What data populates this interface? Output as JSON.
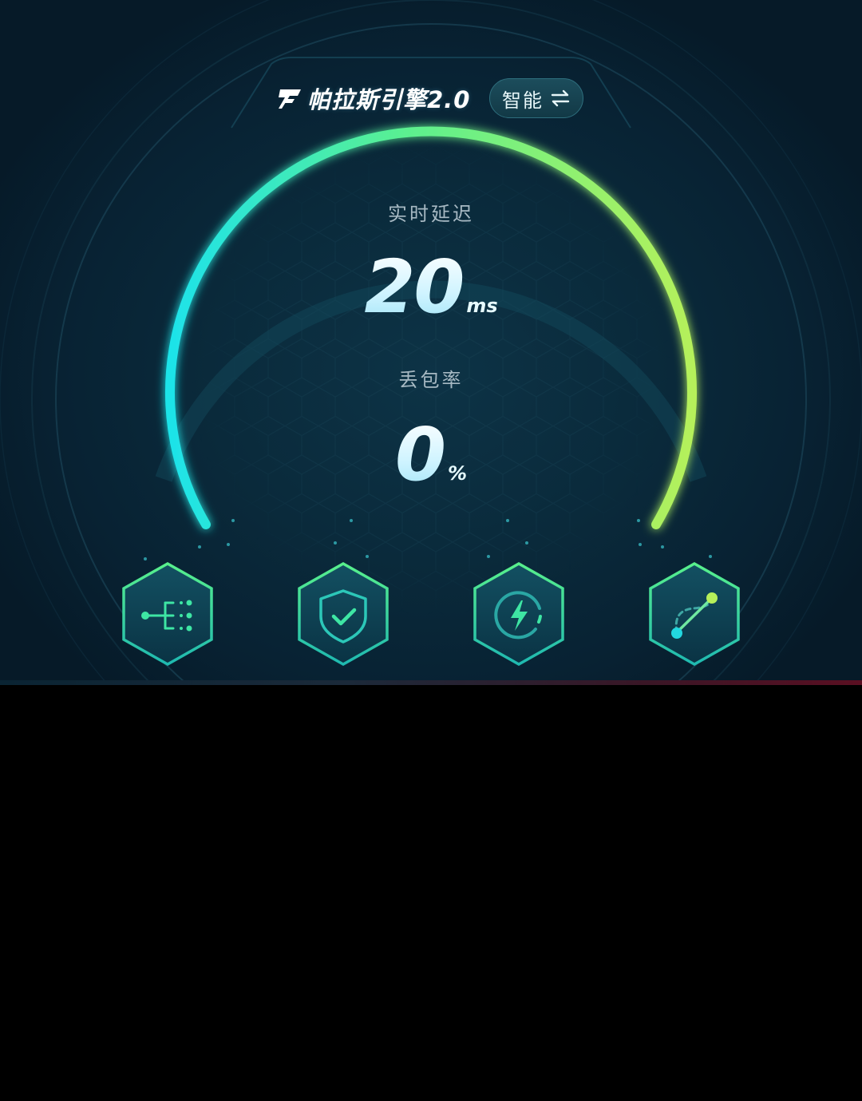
{
  "header": {
    "title": "帕拉斯引擎2.0",
    "mode_button_label": "智能"
  },
  "gauge": {
    "latency_label": "实时延迟",
    "latency_value": "20",
    "latency_unit": "ms",
    "packet_loss_label": "丢包率",
    "packet_loss_value": "0",
    "packet_loss_unit": "%"
  },
  "feature_buttons": [
    {
      "icon": "network-split-icon"
    },
    {
      "icon": "shield-check-icon"
    },
    {
      "icon": "lightning-boost-icon"
    },
    {
      "icon": "route-connect-icon"
    }
  ],
  "colors": {
    "arc_start": "#1fe3e8",
    "arc_end": "#b6f05a",
    "accent": "#3ee6a4",
    "background": "#0a2a3b"
  }
}
